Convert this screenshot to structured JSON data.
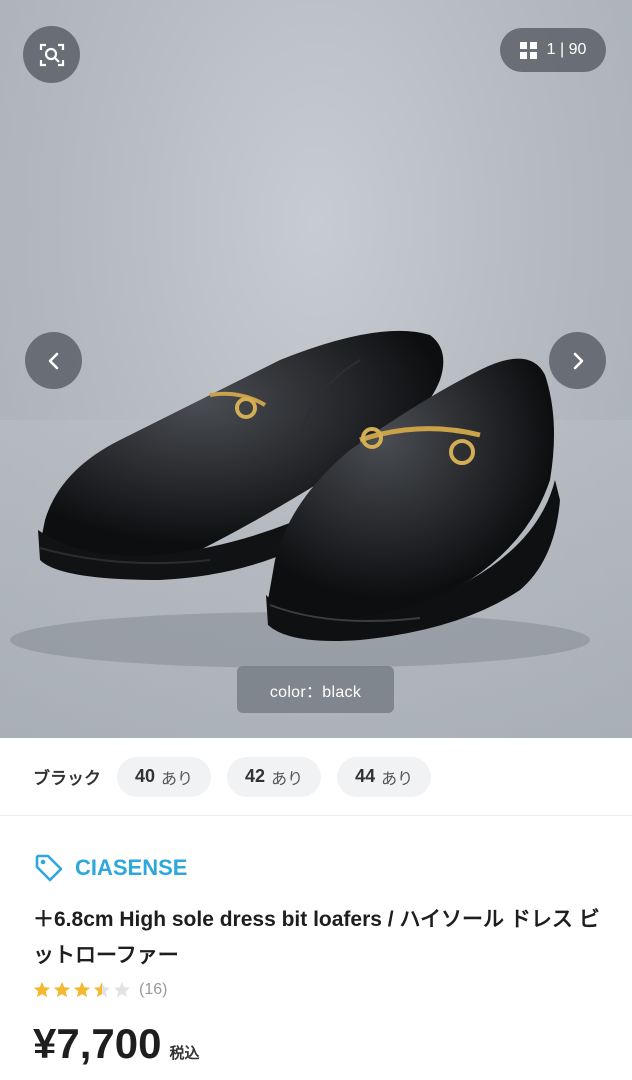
{
  "gallery": {
    "counter_text": "1 | 90",
    "caption": "color：black",
    "icons": {
      "lens": "image-search-icon",
      "grid": "grid-icon",
      "prev": "chevron-left-icon",
      "next": "chevron-right-icon"
    }
  },
  "variants": {
    "color_label": "ブラック",
    "sizes": [
      {
        "size": "40",
        "stock": "あり"
      },
      {
        "size": "42",
        "stock": "あり"
      },
      {
        "size": "44",
        "stock": "あり"
      }
    ]
  },
  "product": {
    "brand": "CIASENSE",
    "brand_icon": "tag-icon",
    "title": "＋6.8cm High sole dress bit loafers / ハイソール ドレス ビットローファー",
    "rating": 3.5,
    "review_count": "(16)",
    "price": "¥7,700",
    "tax_label": "税込"
  },
  "colors": {
    "brand": "#2ea7dd",
    "star": "#f5b82e",
    "star_empty": "#e2e2e2"
  }
}
